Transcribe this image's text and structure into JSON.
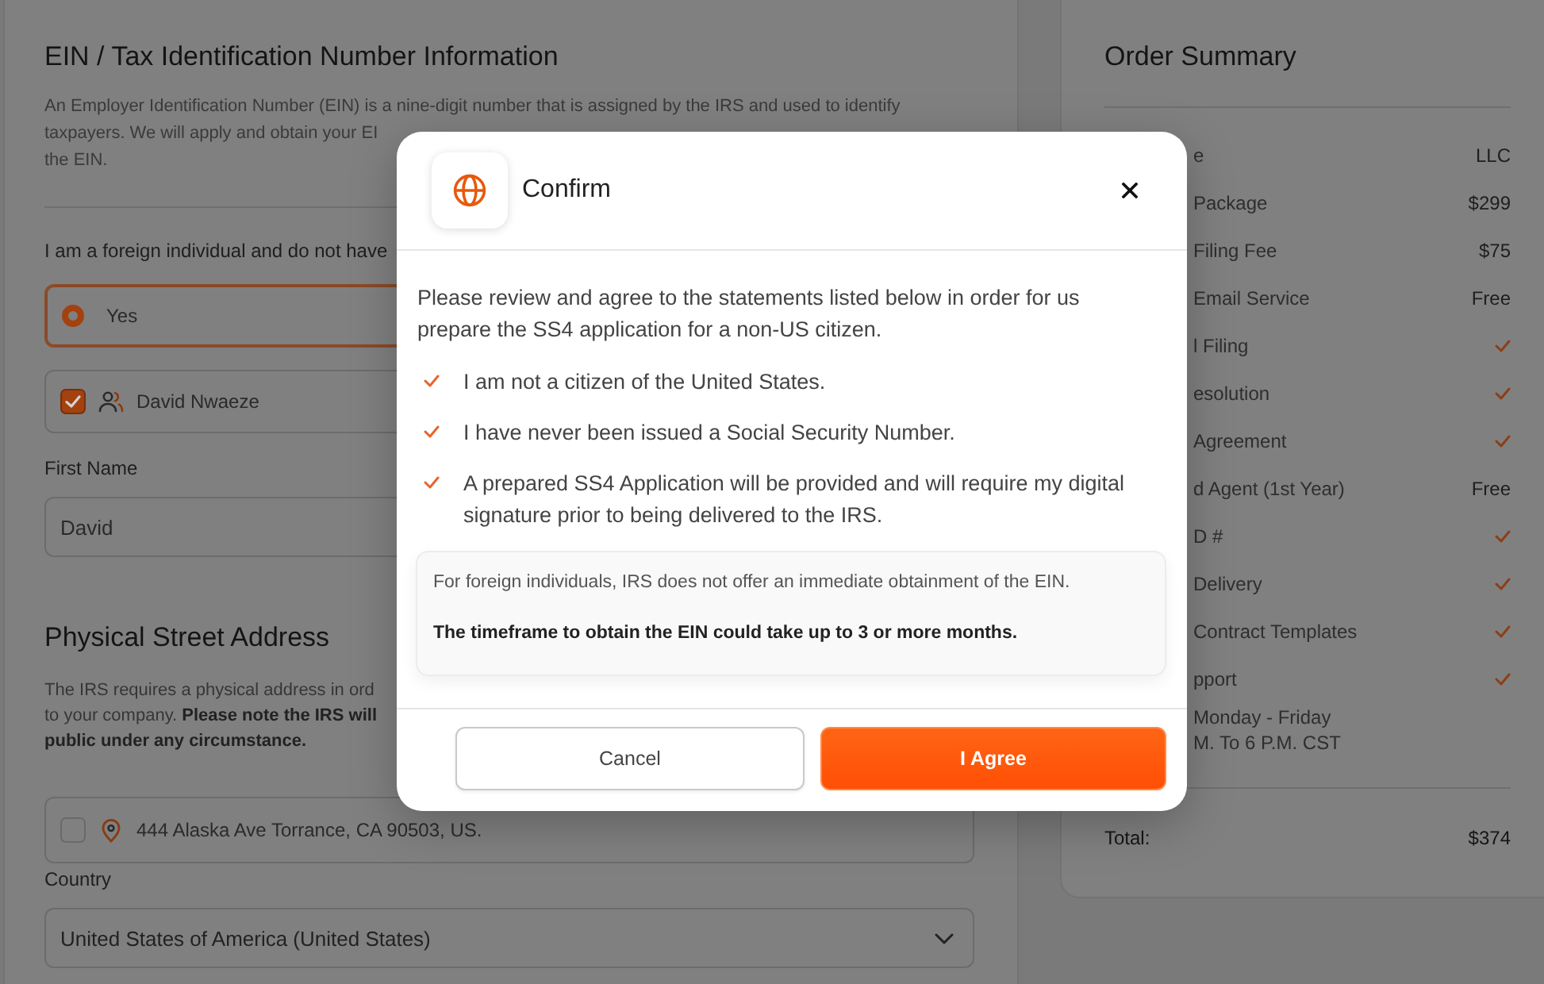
{
  "ein_section": {
    "title": "EIN / Tax Identification Number Information",
    "description": "An Employer Identification Number (EIN) is a nine-digit number that is assigned by the IRS and used to identify\ntaxpayers. We will apply and obtain your EI\nthe EIN.",
    "question": "I am a foreign individual and do not have",
    "options": [
      {
        "label": "Yes",
        "selected": true
      }
    ],
    "members": [
      {
        "name": "David Nwaeze",
        "checked": true
      }
    ],
    "first_name": {
      "label": "First Name",
      "value": "David"
    }
  },
  "address_section": {
    "title": "Physical Street Address",
    "description": "The IRS requires a physical address in ord\nto your company. **Please note the IRS will**\n**public under any circumstance.**",
    "addresses": [
      {
        "text": "444 Alaska Ave Torrance, CA 90503, US.",
        "checked": false
      }
    ],
    "country": {
      "label": "Country",
      "value": "United States of America (United States)"
    }
  },
  "order_summary": {
    "title": "Order Summary",
    "rows": [
      {
        "label": "e",
        "kind": "text",
        "value": "LLC"
      },
      {
        "label": "Package",
        "kind": "text",
        "value": "$299"
      },
      {
        "label": "Filing Fee",
        "kind": "text",
        "value": "$75"
      },
      {
        "label": "Email Service",
        "kind": "text",
        "value": "Free"
      },
      {
        "label": "l Filing",
        "kind": "check"
      },
      {
        "label": "esolution",
        "kind": "check"
      },
      {
        "label": "Agreement",
        "kind": "check"
      },
      {
        "label": "d Agent (1st Year)",
        "kind": "text",
        "value": "Free"
      },
      {
        "label": "D #",
        "kind": "check"
      },
      {
        "label": "Delivery",
        "kind": "check"
      },
      {
        "label": "Contract Templates",
        "kind": "check"
      },
      {
        "label": "pport",
        "kind": "check",
        "notes": [
          "Monday - Friday",
          "M. To 6 P.M. CST"
        ]
      }
    ],
    "total": {
      "label": "Total:",
      "value": "$374"
    }
  },
  "modal": {
    "title": "Confirm",
    "intro": "Please review and agree to the statements listed below in order for us prepare the SS4 application for a non-US citizen.",
    "statements": [
      "I am not a citizen of the United States.",
      "I have never been issued a Social Security Number.",
      "A prepared SS4 Application will be provided and will require my digital signature prior to being delivered to the IRS."
    ],
    "notice": [
      {
        "text": "For foreign individuals, IRS does not offer an immediate obtainment of the EIN.",
        "kind": "plain"
      },
      {
        "text": "The timeframe to obtain the EIN could take up to 3 or more months.",
        "kind": "strong"
      }
    ],
    "buttons": [
      {
        "label": "Cancel",
        "kind": "secondary"
      },
      {
        "label": "I Agree",
        "kind": "primary"
      }
    ]
  }
}
